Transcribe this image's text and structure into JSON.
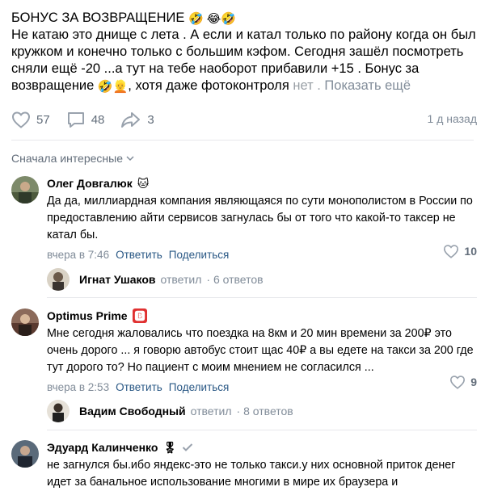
{
  "post": {
    "title": "БОНУС ЗА ВОЗВРАЩЕНИЕ",
    "line1": "Не катаю это днище с лета . А если и катал только по району когда он был",
    "line2": "кружком и конечно только с большим кэфом. Сегодня зашёл посмотреть",
    "line3": "сняли ещё -20 ...а тут на тебе наоборот прибавили +15 . Бонус за",
    "line4_a": "возвращение",
    "line4_b": ", хотя даже фотоконтроля ",
    "line4_fade": "нет .",
    "show_more": "Показать ещё",
    "emoji_title": "🤣 😂🤣",
    "emoji_line4": "🤣👱"
  },
  "actions": {
    "likes": "57",
    "comments": "48",
    "shares": "3",
    "time": "1 д назад"
  },
  "sort": {
    "label": "Сначала интересные"
  },
  "comments": [
    {
      "author": "Олег Довгалюк",
      "badge": "🐱",
      "text": "Да да, миллиардная компания являющаяся по сути монополистом в России по предоставлению айти сервисов загнулась бы от того что какой-то таксер не катал бы.",
      "time": "вчера в 7:46",
      "reply_label": "Ответить",
      "share_label": "Поделиться",
      "likes": "10",
      "reply": {
        "name": "Игнат Ушаков",
        "verb": "ответил",
        "count": "· 6 ответов"
      }
    },
    {
      "author": "Optimus Prime",
      "badge": "🅱",
      "text": "Мне сегодня жаловались что поездка на 8км и 20 мин времени за 200₽ это очень дорого ... я говорю автобус стоит щас 40₽ а вы едете на такси за 200 где тут дорого то? Но пациент с моим мнением не согласился ...",
      "time": "вчера в 2:53",
      "reply_label": "Ответить",
      "share_label": "Поделиться",
      "likes": "9",
      "reply": {
        "name": "Вадим Свободный",
        "verb": "ответил",
        "count": "· 8 ответов"
      }
    },
    {
      "author": "Эдуард Калинченко",
      "badge": "🎖",
      "text": "не загнулся бы.ибо яндекс-это не только такси.у них основной приток денег идет за банальное использование многими в мире их браузера и"
    }
  ],
  "colors": {
    "link": "#2a5885",
    "muted": "#818c99",
    "icon": "#99a2ad",
    "divider": "#e7e8ec"
  },
  "icons": {
    "like": "heart-icon",
    "comment": "comment-bubble-icon",
    "share": "share-arrow-icon",
    "sort": "chevron-down-icon",
    "verified": "check-icon"
  }
}
